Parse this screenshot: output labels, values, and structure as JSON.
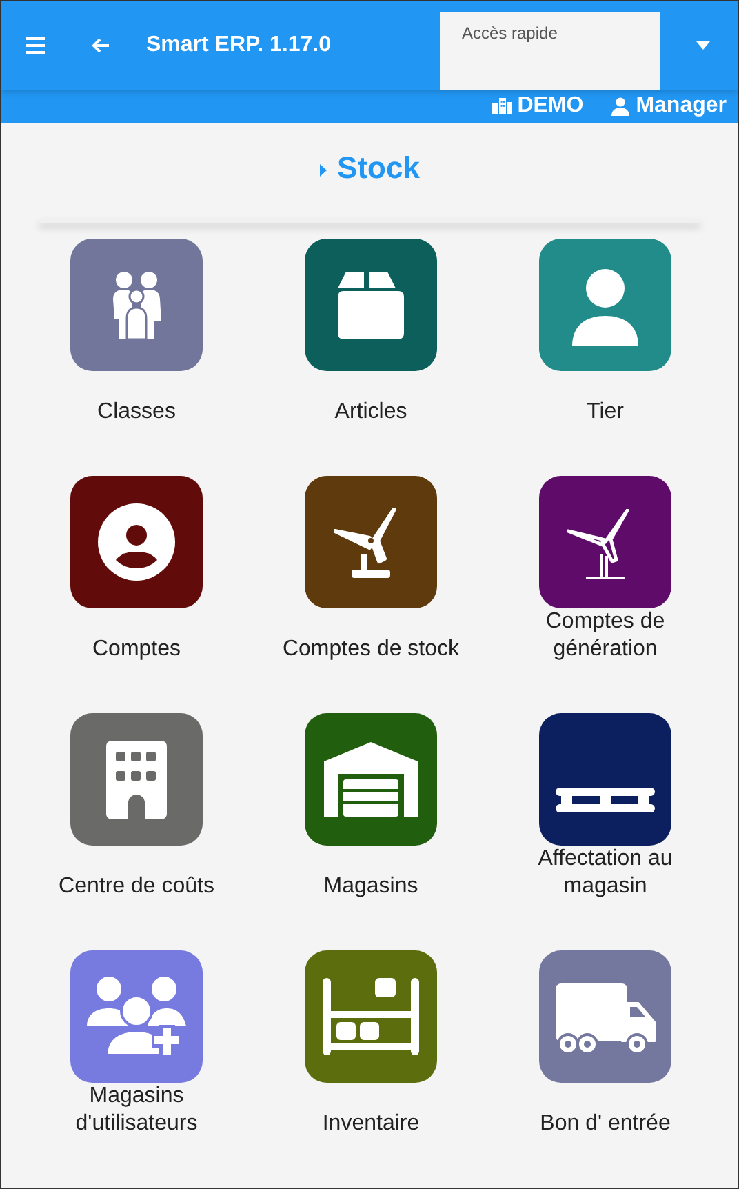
{
  "app_bar": {
    "title": "Smart ERP. 1.17.0",
    "quick_access": {
      "label": "Accès rapide"
    }
  },
  "sub_bar": {
    "company": "DEMO",
    "user": "Manager"
  },
  "section": {
    "title": "Stock"
  },
  "tiles": [
    {
      "label": "Classes",
      "color": "#72769b"
    },
    {
      "label": "Articles",
      "color": "#0d5f5c"
    },
    {
      "label": "Tier",
      "color": "#228c8a"
    },
    {
      "label": "Comptes",
      "color": "#620b0b"
    },
    {
      "label": "Comptes de stock",
      "color": "#5e3a0c"
    },
    {
      "label": "Comptes de génération",
      "color": "#5f0b6a"
    },
    {
      "label": "Centre de coûts",
      "color": "#6a6b69"
    },
    {
      "label": "Magasins",
      "color": "#215e0e"
    },
    {
      "label": "Affectation au magasin",
      "color": "#0c1f5e"
    },
    {
      "label": "Magasins d'utilisateurs",
      "color": "#777be0"
    },
    {
      "label": "Inventaire",
      "color": "#5c6d0e"
    },
    {
      "label": "Bon d' entrée",
      "color": "#75789e"
    }
  ]
}
